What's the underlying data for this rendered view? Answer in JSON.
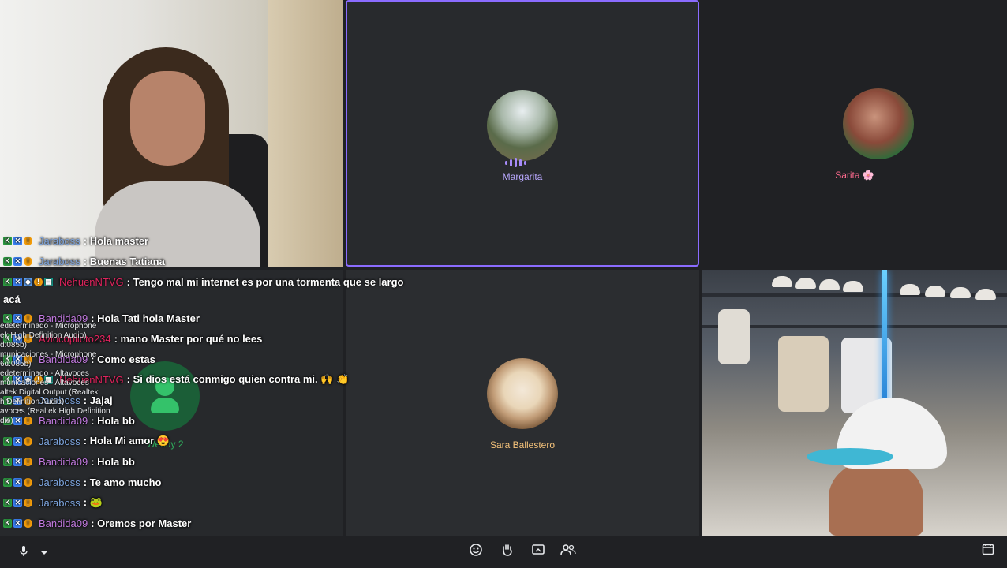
{
  "participants": {
    "top_middle": {
      "name": "Margarita"
    },
    "top_right": {
      "name": "Sarita 🌸"
    },
    "bottom_left": {
      "name": "Wendy 2"
    },
    "bottom_middle": {
      "name": "Sara Ballestero"
    }
  },
  "chat": {
    "messages": [
      {
        "user": "Jaraboss",
        "user_color": "#7ea6e0",
        "badges": [
          "k",
          "x",
          "c"
        ],
        "text": ": Hola master"
      },
      {
        "user": "Jaraboss",
        "user_color": "#7ea6e0",
        "badges": [
          "k",
          "x",
          "c"
        ],
        "text": ": Buenas Tatiana"
      },
      {
        "user": "NehuenNTVG",
        "user_color": "#e0245e",
        "badges": [
          "k",
          "x",
          "b",
          "c",
          "g"
        ],
        "text": ": Tengo mal mi internet es por una tormenta que se largo",
        "continuation": "acá"
      },
      {
        "user": "Bandida09",
        "user_color": "#c27ae0",
        "badges": [
          "k",
          "x",
          "c"
        ],
        "text": ": Hola Tati hola Master"
      },
      {
        "user": "Aviocopiloto234",
        "user_color": "#e0245e",
        "badges": [
          "k",
          "x",
          "c"
        ],
        "text": ": mano Master por qué no lees"
      },
      {
        "user": "Bandida09",
        "user_color": "#c27ae0",
        "badges": [
          "k",
          "x",
          "c"
        ],
        "text": ": Como estas"
      },
      {
        "user": "NehuenNTVG",
        "user_color": "#e0245e",
        "badges": [
          "k",
          "x",
          "b",
          "c",
          "g"
        ],
        "text": ": Si dios está conmigo quien contra mi. 🙌 👏"
      },
      {
        "user": "Jaraboss",
        "user_color": "#7ea6e0",
        "badges": [
          "k",
          "x",
          "c"
        ],
        "text": ": Jajaj"
      },
      {
        "user": "Bandida09",
        "user_color": "#c27ae0",
        "badges": [
          "k",
          "x",
          "c"
        ],
        "text": ": Hola bb"
      },
      {
        "user": "Jaraboss",
        "user_color": "#7ea6e0",
        "badges": [
          "k",
          "x",
          "c"
        ],
        "text": ": Hola Mi amor 😍"
      },
      {
        "user": "Bandida09",
        "user_color": "#c27ae0",
        "badges": [
          "k",
          "x",
          "c"
        ],
        "text": ": Hola bb"
      },
      {
        "user": "Jaraboss",
        "user_color": "#7ea6e0",
        "badges": [
          "k",
          "x",
          "c"
        ],
        "text": ": Te amo mucho"
      },
      {
        "user": "Jaraboss",
        "user_color": "#7ea6e0",
        "badges": [
          "k",
          "x",
          "c"
        ],
        "text": ": 🐸"
      },
      {
        "user": "Bandida09",
        "user_color": "#c27ae0",
        "badges": [
          "k",
          "x",
          "c"
        ],
        "text": ": Oremos por Master"
      }
    ]
  },
  "audio_devices": [
    "edeterminado - Microphone",
    "ek High Definition Audio)",
    "d:085b)",
    "municaciones - Microphone",
    "6d:085b)",
    "edeterminado - Altavoces",
    "municaciones - Altavoces",
    "altek Digital Output (Realtek",
    "h Definition Audio)",
    "avoces (Realtek High Definition",
    "dio)"
  ],
  "icons": {
    "mute": "mic-off-icon",
    "mic": "mic-icon",
    "chevron": "chevron-up-icon",
    "emoji": "emoji-icon",
    "raise_hand": "raise-hand-icon",
    "present": "present-icon",
    "people": "people-icon",
    "calendar": "calendar-icon"
  },
  "colors": {
    "active_speaker_border": "#8b6cff",
    "margarita_name": "#b9a8ff",
    "sarita_name": "#ff6b8f",
    "sara_name": "#f4c27a",
    "wendy_name": "#2fae5d"
  }
}
